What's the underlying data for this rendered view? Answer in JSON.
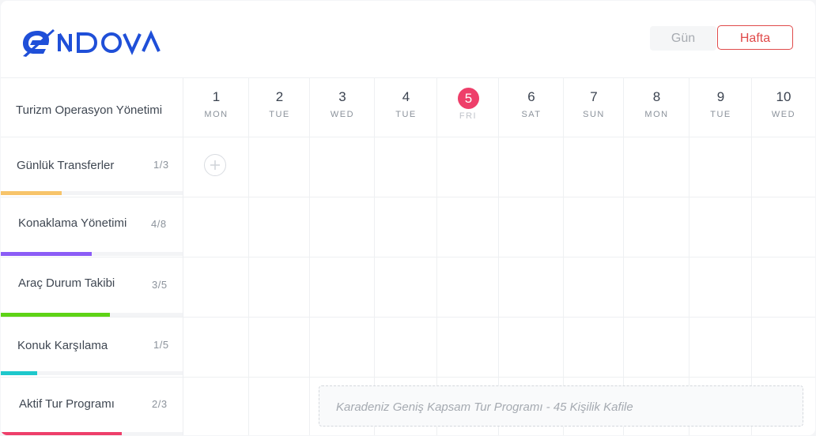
{
  "app": {
    "logo_text": "ENDOVA"
  },
  "view_switch": {
    "day_label": "Gün",
    "week_label": "Hafta",
    "active": "Hafta"
  },
  "sidebar": {
    "title": "Turizm Operasyon Yönetimi",
    "rows": [
      {
        "label": "Günlük Transferler",
        "count": "1/3",
        "progress": 0.3333,
        "color": "#f7c46a"
      },
      {
        "label": "Konaklama Yönetimi",
        "count": "4/8",
        "progress": 0.5,
        "color": "#8b5cf6"
      },
      {
        "label": "Araç Durum Takibi",
        "count": "3/5",
        "progress": 0.6,
        "color": "#5ed316"
      },
      {
        "label": "Konuk Karşılama",
        "count": "1/5",
        "progress": 0.2,
        "color": "#1ec8cc"
      },
      {
        "label": "Aktif Tur Programı",
        "count": "2/3",
        "progress": 0.6667,
        "color": "#ee3f6a"
      }
    ]
  },
  "days": [
    {
      "num": "1",
      "name": "MON",
      "today": false
    },
    {
      "num": "2",
      "name": "TUE",
      "today": false
    },
    {
      "num": "3",
      "name": "WED",
      "today": false
    },
    {
      "num": "4",
      "name": "TUE",
      "today": false
    },
    {
      "num": "5",
      "name": "FRI",
      "today": true
    },
    {
      "num": "6",
      "name": "SAT",
      "today": false
    },
    {
      "num": "7",
      "name": "SUN",
      "today": false
    },
    {
      "num": "8",
      "name": "MON",
      "today": false
    },
    {
      "num": "9",
      "name": "TUE",
      "today": false
    },
    {
      "num": "10",
      "name": "WED",
      "today": false
    }
  ],
  "event": {
    "text": "Karadeniz Geniş Kapsam Tur Programı - 45 Kişilik Kafile",
    "row": "Aktif Tur Programı",
    "start_day": "3",
    "end_day": "10"
  },
  "colors": {
    "accent": "#e04a4a",
    "today": "#ee3f6a",
    "brand": "#1f4fd8"
  }
}
